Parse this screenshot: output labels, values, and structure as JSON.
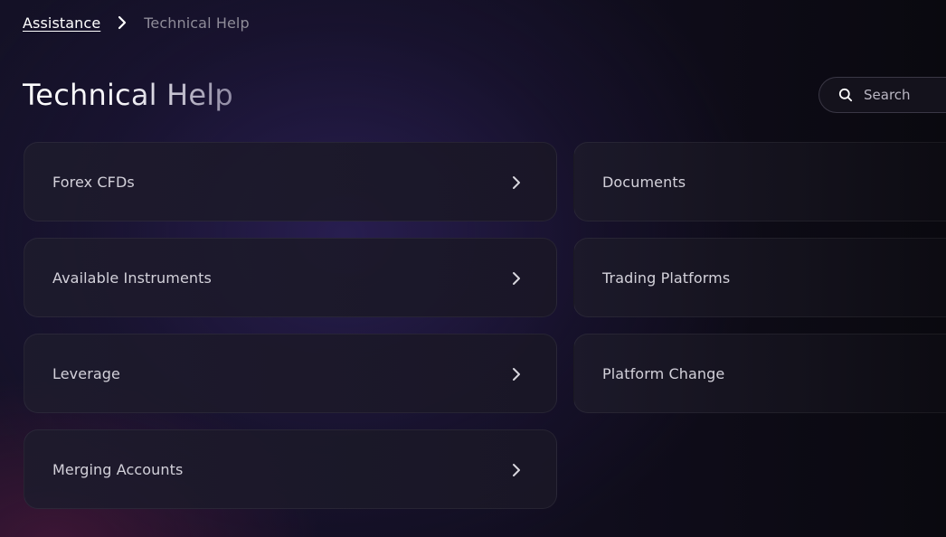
{
  "breadcrumb": {
    "root_label": "Assistance",
    "current_label": "Technical Help"
  },
  "page_title": "Technical Help",
  "search": {
    "placeholder": "Search",
    "value": ""
  },
  "topics_left": [
    {
      "label": "Forex CFDs"
    },
    {
      "label": "Available Instruments"
    },
    {
      "label": "Leverage"
    },
    {
      "label": "Merging Accounts"
    }
  ],
  "topics_right": [
    {
      "label": "Documents"
    },
    {
      "label": "Trading Platforms"
    },
    {
      "label": "Platform Change"
    }
  ],
  "icons": {
    "breadcrumb_separator": "chevron-right-icon",
    "search": "search-icon",
    "card_arrow": "chevron-right-icon"
  },
  "colors": {
    "background": "#0b0a11",
    "accent_glow": "#3a2a76",
    "card_background": "#1e1b2d",
    "text_primary": "#ffffff",
    "text_muted": "#8f8c99",
    "card_text": "#d3d1da"
  }
}
